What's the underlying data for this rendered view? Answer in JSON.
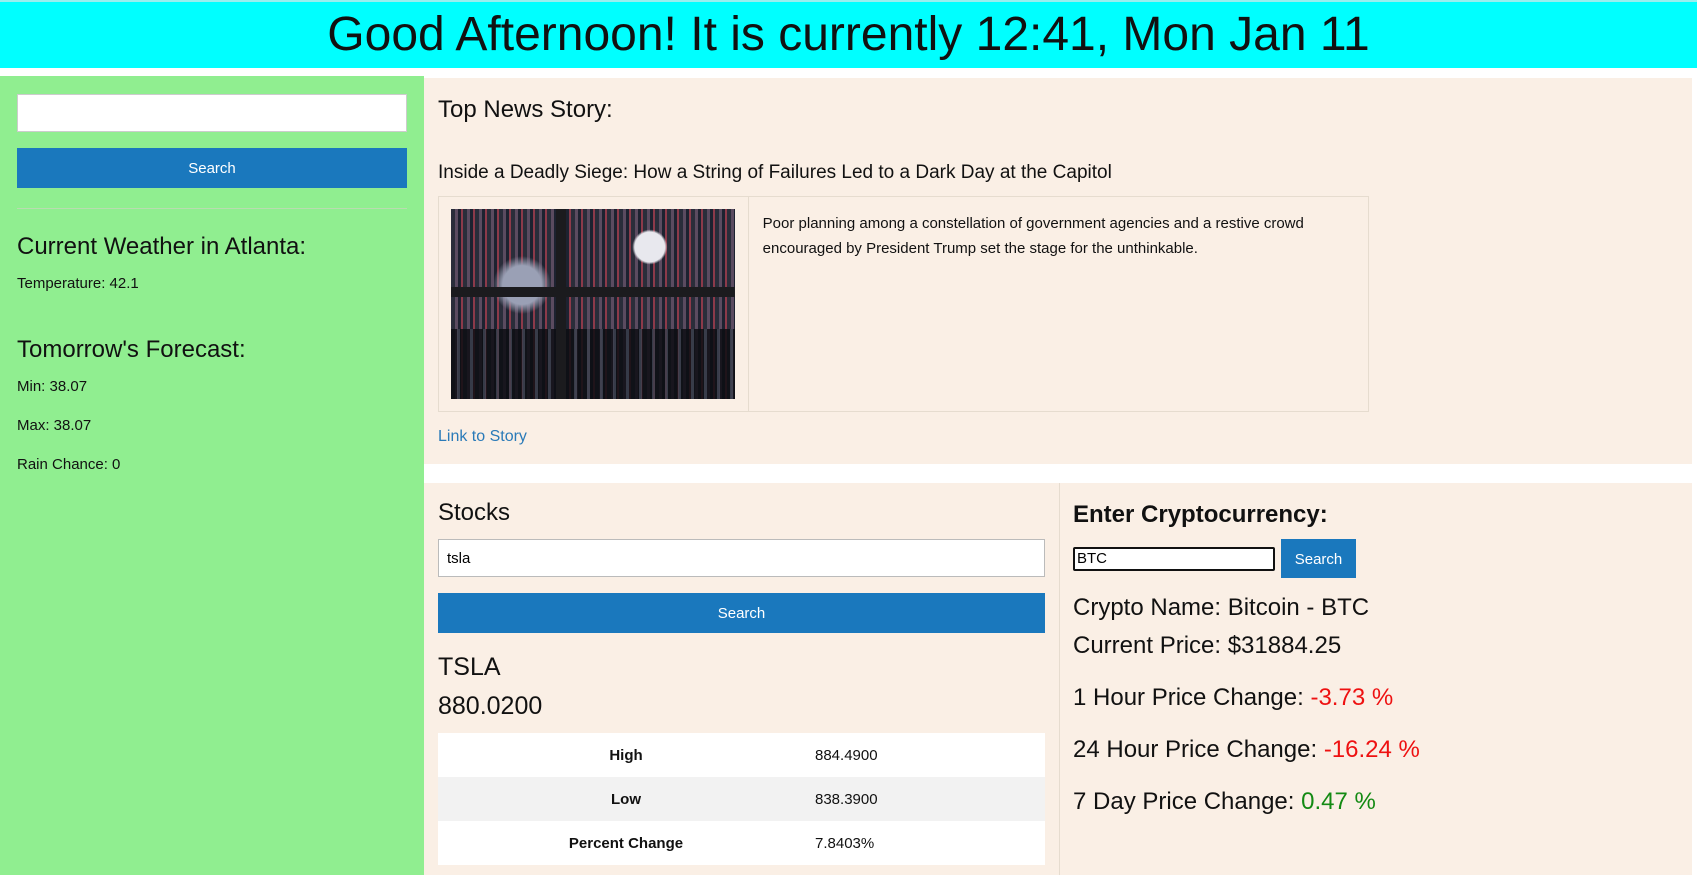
{
  "header": {
    "greeting": "Good Afternoon! It is currently 12:41, Mon Jan 11"
  },
  "sidebar": {
    "search": {
      "value": "",
      "placeholder": ""
    },
    "search_button": "Search",
    "weather_title": "Current Weather in Atlanta:",
    "temperature": "Temperature: 42.1",
    "forecast_title": "Tomorrow's Forecast:",
    "min": "Min: 38.07",
    "max": "Max: 38.07",
    "rain": "Rain Chance: 0"
  },
  "news": {
    "label": "Top News Story:",
    "headline": "Inside a Deadly Siege: How a String of Failures Led to a Dark Day at the Capitol",
    "description": "Poor planning among a constellation of government agencies and a restive crowd encouraged by President Trump set the stage for the unthinkable.",
    "link": "Link to Story"
  },
  "stocks": {
    "label": "Stocks",
    "search": {
      "value": "tsla"
    },
    "search_button": "Search",
    "ticker": "TSLA",
    "price": "880.0200",
    "rows": [
      {
        "key": "High",
        "value": "884.4900"
      },
      {
        "key": "Low",
        "value": "838.3900"
      },
      {
        "key": "Percent Change",
        "value": "7.8403%"
      }
    ]
  },
  "crypto": {
    "label": "Enter Cryptocurrency:",
    "search": {
      "value": "BTC"
    },
    "search_button": "Search",
    "name": "Crypto Name: Bitcoin - BTC",
    "current_price": "Current Price: $31884.25",
    "hour_label": "1 Hour Price Change: ",
    "hour_value": "-3.73 %",
    "day_label": "24 Hour Price Change: ",
    "day_value": "-16.24 %",
    "week_label": "7 Day Price Change: ",
    "week_value": "0.47 %",
    "colors": {
      "negative": "#ee1111",
      "positive": "#138a13"
    }
  },
  "colors": {
    "header_bg": "#00ffff",
    "sidebar_bg": "#90ee90",
    "panel_bg": "#faefe5",
    "button_bg": "#1a78bd",
    "link": "#2a7ab8"
  }
}
